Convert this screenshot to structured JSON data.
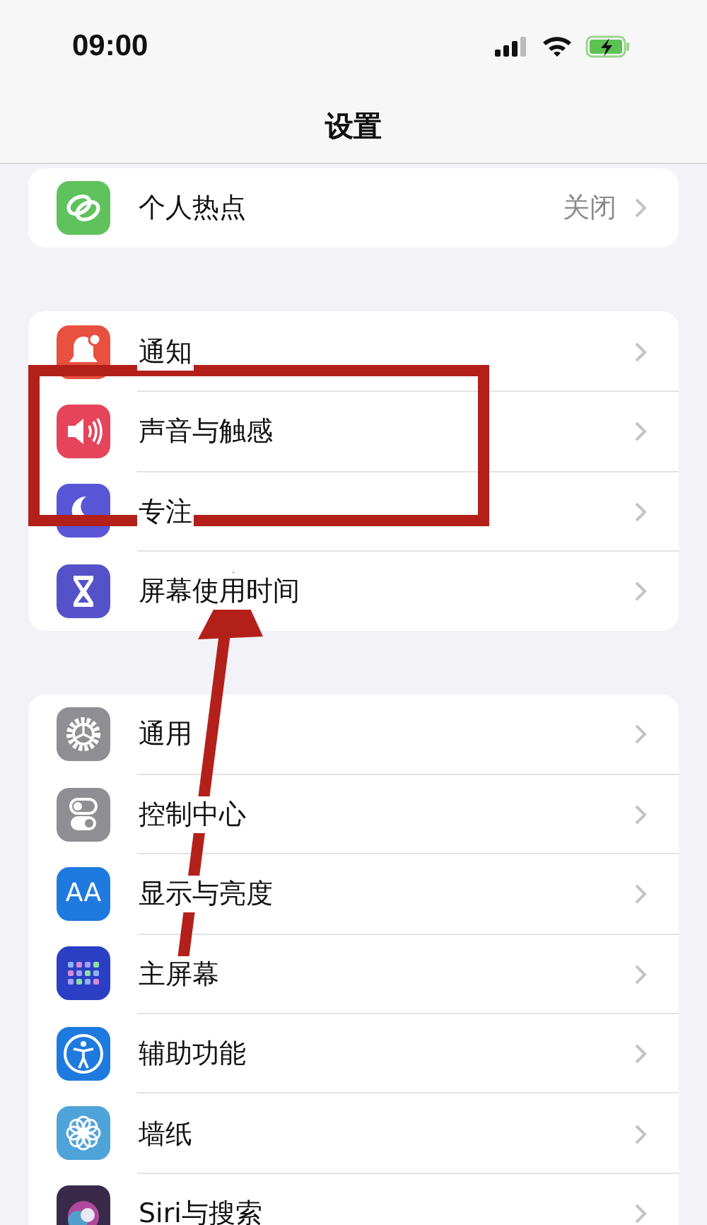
{
  "status_bar": {
    "time": "09:00"
  },
  "nav": {
    "title": "设置"
  },
  "groups": [
    {
      "items": [
        {
          "label": "个人热点",
          "value": "关闭",
          "color": "#5fc25d"
        }
      ]
    },
    {
      "items": [
        {
          "label": "通知",
          "color": "#e8503f"
        },
        {
          "label": "声音与触感",
          "color": "#e5445a"
        },
        {
          "label": "专注",
          "color": "#5856d6"
        },
        {
          "label": "屏幕使用时间",
          "color": "#5552c9"
        }
      ]
    },
    {
      "items": [
        {
          "label": "通用",
          "color": "#8e8e93"
        },
        {
          "label": "控制中心",
          "color": "#8e8e93"
        },
        {
          "label": "显示与亮度",
          "color": "#1f7ae0",
          "icon_text": "AA"
        },
        {
          "label": "主屏幕",
          "color": "#2a3fc4"
        },
        {
          "label": "辅助功能",
          "color": "#1f7ae0"
        },
        {
          "label": "墙纸",
          "color": "#4fa3d9"
        },
        {
          "label": "Siri与搜索",
          "color": "#3a2a4a"
        }
      ]
    }
  ]
}
